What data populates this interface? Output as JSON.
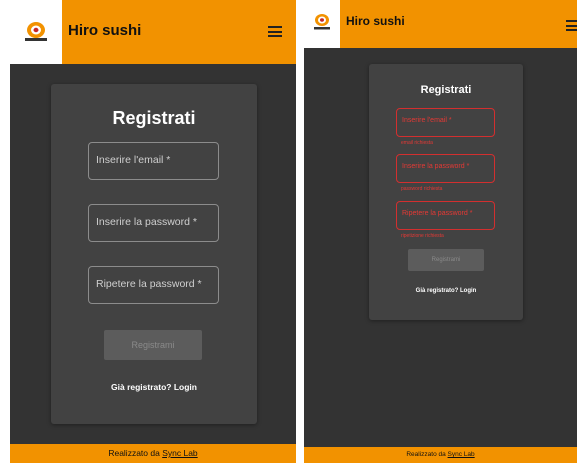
{
  "app": {
    "title": "Hiro sushi"
  },
  "register": {
    "title": "Registrati",
    "email_label": "Inserire l'email *",
    "password_label": "Inserire la password *",
    "repeat_password_label": "Ripetere la password *",
    "submit_label": "Registrami",
    "login_link": "Già registrato? Login"
  },
  "errors": {
    "email": "email richiesta",
    "password": "password richiesta",
    "repeat_password": "ripetizione richiesta"
  },
  "footer": {
    "text": "Realizzato da",
    "link": "Sync Lab"
  },
  "colors": {
    "header": "#f29200",
    "background": "#333333",
    "card": "#424242",
    "error": "#e53935"
  },
  "icons": {
    "logo": "sushi-logo-icon",
    "menu": "hamburger-menu-icon"
  }
}
